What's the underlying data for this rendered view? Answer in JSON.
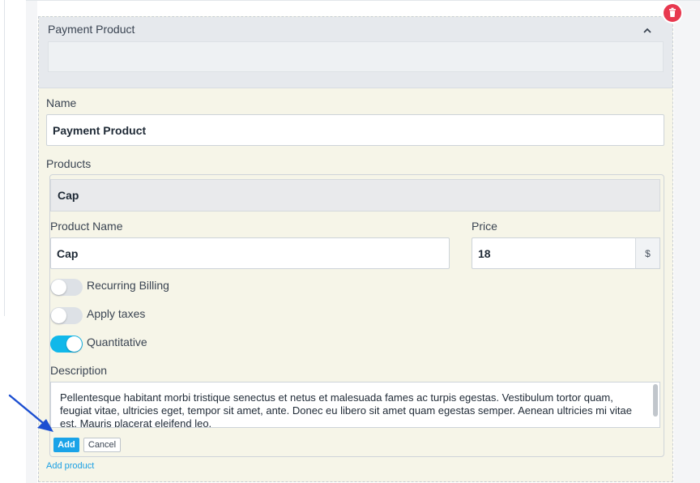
{
  "block": {
    "title": "Payment Product"
  },
  "form": {
    "name_label": "Name",
    "name_value": "Payment Product",
    "products_label": "Products"
  },
  "product": {
    "header": "Cap",
    "product_name_label": "Product Name",
    "product_name_value": "Cap",
    "price_label": "Price",
    "price_value": "18",
    "currency_symbol": "$",
    "toggles": [
      {
        "label": "Recurring Billing",
        "on": false
      },
      {
        "label": "Apply taxes",
        "on": false
      },
      {
        "label": "Quantitative",
        "on": true
      }
    ],
    "description_label": "Description",
    "description_value": "Pellentesque habitant morbi tristique senectus et netus et malesuada fames ac turpis egestas. Vestibulum tortor quam, feugiat vitae, ultricies eget, tempor sit amet, ante. Donec eu libero sit amet quam egestas semper. Aenean ultricies mi vitae est. Mauris placerat eleifend leo.",
    "add_button": "Add",
    "cancel_button": "Cancel"
  },
  "add_product_link": "Add product",
  "icons": {
    "delete": "trash-icon",
    "collapse": "chevron-up-icon",
    "annotation": "arrow-icon"
  },
  "colors": {
    "accent": "#11b8ea",
    "delete": "#e8384f",
    "arrow": "#1c4fd1"
  }
}
